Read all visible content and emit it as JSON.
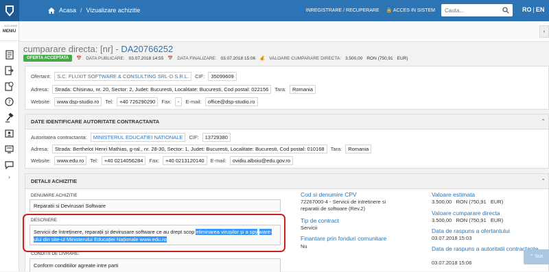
{
  "header": {
    "breadcrumb_home": "Acasa",
    "breadcrumb_page": "Vizualizare achizitie",
    "register_link": "INREGISTRARE / RECUPERARE",
    "login_link": "ACCES IN SISTEM",
    "search_placeholder": "Cauta...",
    "lang_ro": "RO",
    "lang_en": "EN"
  },
  "sidebar": {
    "menu_small": "← ASCUNDE",
    "menu_label": "MENIU"
  },
  "purchase": {
    "title_prefix": "cumparare directa: [nr] -",
    "code": "DA20766252",
    "status_badge": "OFERTA ACCEPTATA",
    "publish_label": "DATA PUBLICARE:",
    "publish_date": "03.07.2018 14:55",
    "final_label": "DATA FINALIZARE:",
    "final_date": "03.07.2018 15:06",
    "value_label": "VALOARE CUMPARARE DIRECTA:",
    "value": "3.500,00",
    "value_ron": "RON (750,91",
    "value_eur": "EUR)"
  },
  "ofertant": {
    "label": "Ofertant:",
    "name": "S.C. FLUXIT SOFTWARE & CONSULTING SRL-D S.R.L.",
    "cif_label": "CIF:",
    "cif": "35099609",
    "addr_label": "Adresa:",
    "address": "Strada: Chisinau, nr. 20, Sector: 2, Judet: Bucuresti, Localitate: Bucuresti, Cod postal: 022156",
    "tara_label": "Tara:",
    "tara": "Romania",
    "web_label": "Website:",
    "website": "www.dsp-studio.ro",
    "tel_label": "Tel:",
    "tel": "+40 726290290",
    "fax_label": "Fax:",
    "fax": "-",
    "email_label": "E-mail:",
    "email": "office@dsp-studio.ro"
  },
  "autoritate": {
    "section_title": "DATE IDENTIFICARE AUTORITATE CONTRACTANTA",
    "label": "Autoritatea contractanta:",
    "name": "MINISTERUL EDUCATIEI NATIONALE",
    "cif_label": "CIF:",
    "cif": "13729380",
    "addr_label": "Adresa:",
    "address": "Strada: Berthelot Henri Mathias, g-ral., nr. 28-30, Sector: 1, Judet: Bucuresti, Localitate: Bucuresti, Cod postal: 010168",
    "tara_label": "Tara:",
    "tara": "Romania",
    "web_label": "Website:",
    "website": "www.edu.ro",
    "tel_label": "Tel:",
    "tel": "+40 0214056284",
    "fax_label": "Fax:",
    "fax": "+40 0213120140",
    "email_label": "E-mail:",
    "email": "ovidiu.alboiu@edu.gov.ro"
  },
  "detalii": {
    "section_title": "DETALII ACHIZITIE",
    "denumire_label": "DENUMIRE ACHIZITIE",
    "denumire": "Reparatii si Devirusari Software",
    "descriere_label": "DESCRIERE",
    "descriere_plain": "Servicii de întreținere, reparații și devirusare software ce au drept scop ",
    "descriere_hl1": "eliminarea virușilor și a spy",
    "descriere_hl2": "ware-ului din site-ul Ministerului Educației Naționale www.edu.ro",
    "conditii_label": "CONDITII DE LIVRARE:",
    "conditii": "Conform conditiilor agreate intre parti",
    "cpv_title": "Cod si denumire CPV",
    "cpv_value": "72267000-4 - Servicii de intretinere si reparatii de software (Rev.2)",
    "tip_title": "Tip de contract",
    "tip_value": "Servicii",
    "fin_title": "Finantare prin fonduri comunitare",
    "fin_value": "Nu",
    "est_title": "Valoare estimata",
    "est_value": "3.500,00   RON (750,91   EUR)",
    "vcd_title": "Valoare cumparare directa",
    "vcd_value": "3.500,00   RON (750,91   EUR)",
    "dro_title": "Data de raspuns a ofertantului",
    "dro_value": "03.07.2018 15:03",
    "dra_title": "Data de raspuns a autoritatii contractante",
    "dra_value": "03.07.2018 15:06"
  },
  "scroll_up": "Sus"
}
